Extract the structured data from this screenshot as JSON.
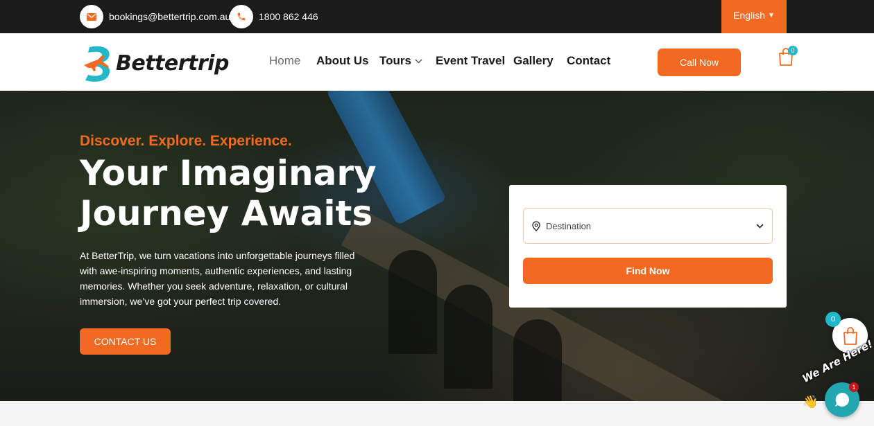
{
  "topbar": {
    "email": "bookings@bettertrip.com.au",
    "phone": "1800 862 446",
    "language": "English",
    "email_icon": "envelope-icon",
    "phone_icon": "phone-icon"
  },
  "header": {
    "logo_text": "Bettertrip",
    "nav": {
      "home": "Home",
      "about": "About Us",
      "tours": "Tours",
      "event": "Event Travel",
      "gallery": "Gallery",
      "contact": "Contact"
    },
    "call_now": "Call Now",
    "cart_count": "0"
  },
  "hero": {
    "tagline": "Discover. Explore. Experience.",
    "title": "Your Imaginary Journey Awaits",
    "description": "At BetterTrip, we turn vacations into unforgettable journeys filled with awe-inspiring moments, authentic experiences, and lasting memories. Whether you seek adventure, relaxation, or cultural immersion, we’ve got your perfect trip covered.",
    "contact_button": "CONTACT US"
  },
  "search": {
    "destination_placeholder": "Destination",
    "find_button": "Find Now"
  },
  "widgets": {
    "cart_count": "0",
    "chat_label": "We Are Here!",
    "chat_unread": "1"
  },
  "colors": {
    "accent": "#f26a21",
    "teal": "#22b8c9",
    "topbar": "#1b1b1b"
  }
}
